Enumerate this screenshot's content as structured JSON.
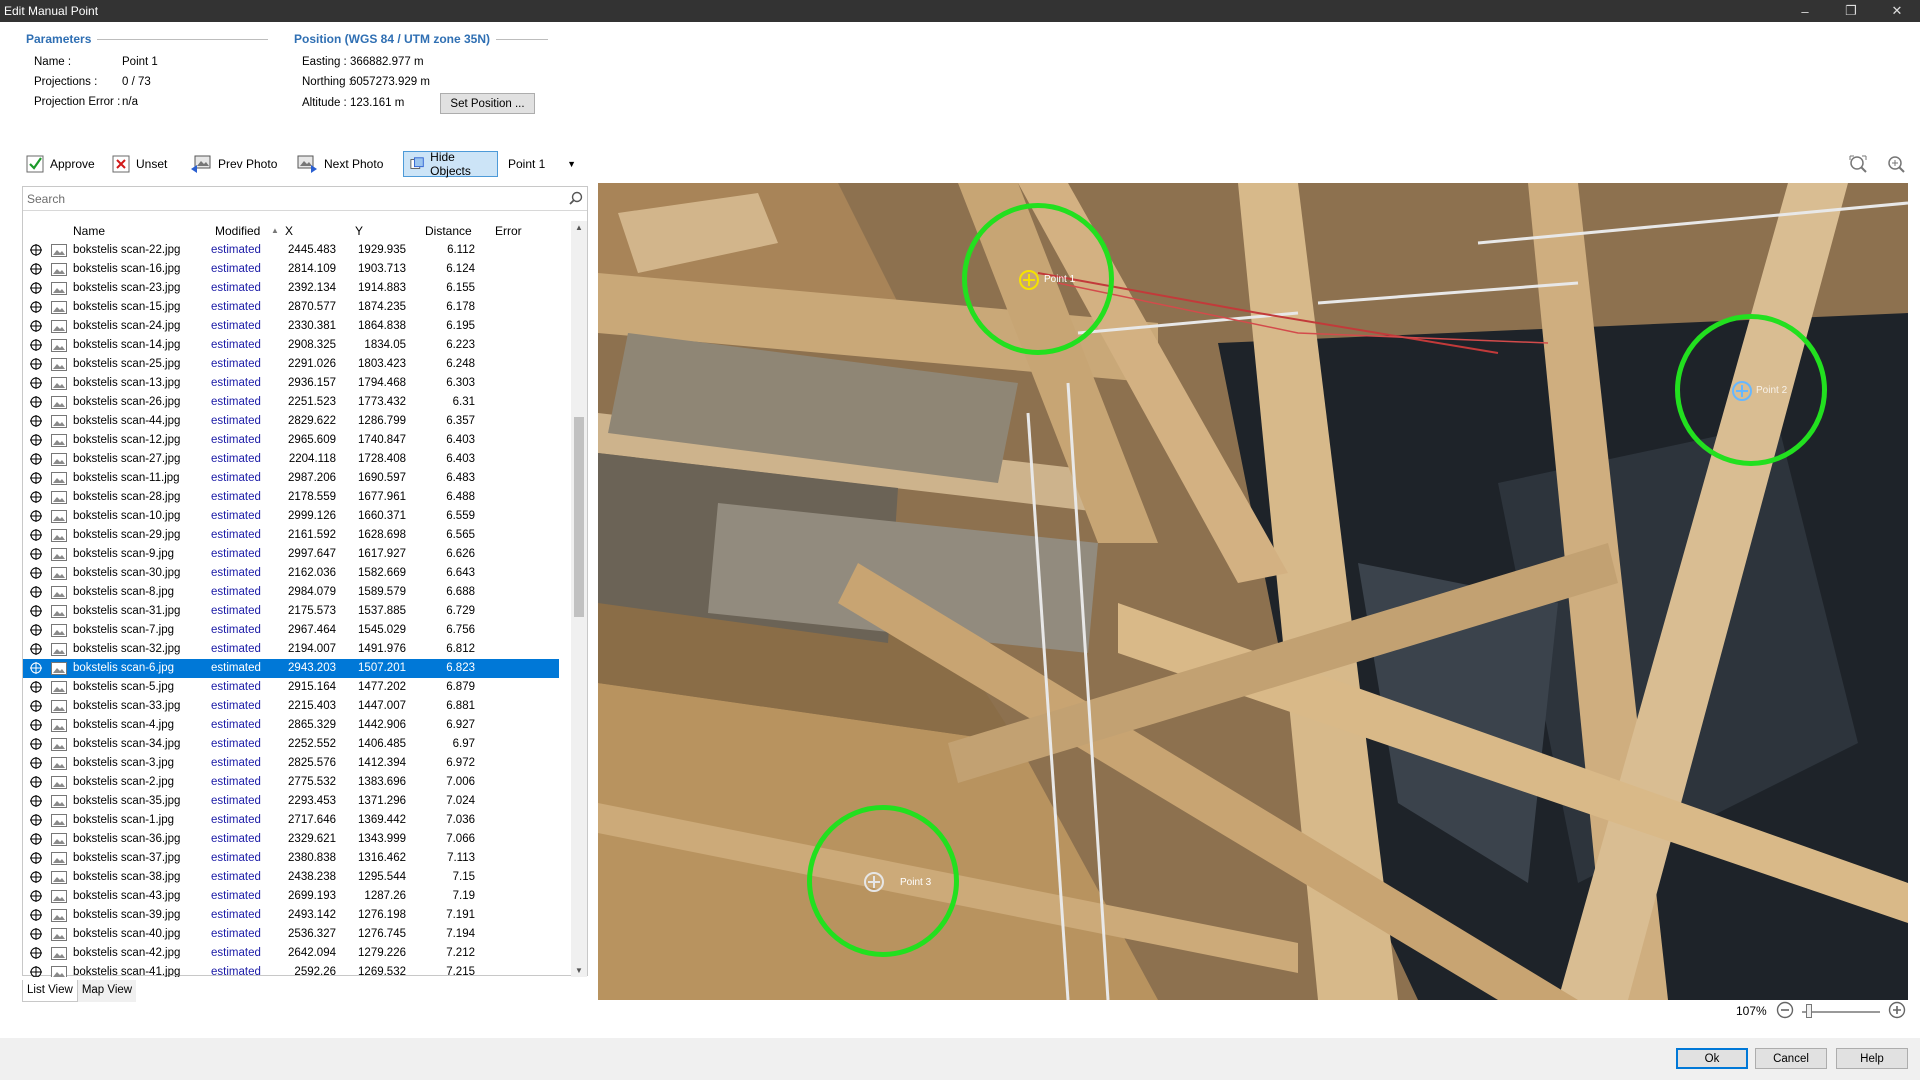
{
  "window": {
    "title": "Edit Manual Point",
    "minimize": "–",
    "restore": "❐",
    "close": "✕"
  },
  "parameters": {
    "heading": "Parameters",
    "name_label": "Name :",
    "name_value": "Point 1",
    "projections_label": "Projections :",
    "projections_value": "0 / 73",
    "projection_error_label": "Projection Error :",
    "projection_error_value": "n/a"
  },
  "position": {
    "heading": "Position (WGS 84 / UTM zone 35N)",
    "easting_label": "Easting :",
    "easting_value": "366882.977 m",
    "northing_label": "Northing :",
    "northing_value": "6057273.929 m",
    "altitude_label": "Altitude :",
    "altitude_value": "123.161 m",
    "set_position_label": "Set Position ..."
  },
  "toolbar": {
    "approve": "Approve",
    "unset": "Unset",
    "prev_photo": "Prev Photo",
    "next_photo": "Next Photo",
    "hide_objects": "Hide Objects",
    "point_select": "Point 1"
  },
  "list": {
    "search_placeholder": "Search",
    "columns": {
      "name": "Name",
      "modified": "Modified",
      "x": "X",
      "y": "Y",
      "distance": "Distance",
      "error": "Error"
    },
    "selected_index": 22,
    "rows": [
      [
        "bokstelis scan-22.jpg",
        "estimated",
        "2445.483",
        "1929.935",
        "6.112"
      ],
      [
        "bokstelis scan-16.jpg",
        "estimated",
        "2814.109",
        "1903.713",
        "6.124"
      ],
      [
        "bokstelis scan-23.jpg",
        "estimated",
        "2392.134",
        "1914.883",
        "6.155"
      ],
      [
        "bokstelis scan-15.jpg",
        "estimated",
        "2870.577",
        "1874.235",
        "6.178"
      ],
      [
        "bokstelis scan-24.jpg",
        "estimated",
        "2330.381",
        "1864.838",
        "6.195"
      ],
      [
        "bokstelis scan-14.jpg",
        "estimated",
        "2908.325",
        "1834.05",
        "6.223"
      ],
      [
        "bokstelis scan-25.jpg",
        "estimated",
        "2291.026",
        "1803.423",
        "6.248"
      ],
      [
        "bokstelis scan-13.jpg",
        "estimated",
        "2936.157",
        "1794.468",
        "6.303"
      ],
      [
        "bokstelis scan-26.jpg",
        "estimated",
        "2251.523",
        "1773.432",
        "6.31"
      ],
      [
        "bokstelis scan-44.jpg",
        "estimated",
        "2829.622",
        "1286.799",
        "6.357"
      ],
      [
        "bokstelis scan-12.jpg",
        "estimated",
        "2965.609",
        "1740.847",
        "6.403"
      ],
      [
        "bokstelis scan-27.jpg",
        "estimated",
        "2204.118",
        "1728.408",
        "6.403"
      ],
      [
        "bokstelis scan-11.jpg",
        "estimated",
        "2987.206",
        "1690.597",
        "6.483"
      ],
      [
        "bokstelis scan-28.jpg",
        "estimated",
        "2178.559",
        "1677.961",
        "6.488"
      ],
      [
        "bokstelis scan-10.jpg",
        "estimated",
        "2999.126",
        "1660.371",
        "6.559"
      ],
      [
        "bokstelis scan-29.jpg",
        "estimated",
        "2161.592",
        "1628.698",
        "6.565"
      ],
      [
        "bokstelis scan-9.jpg",
        "estimated",
        "2997.647",
        "1617.927",
        "6.626"
      ],
      [
        "bokstelis scan-30.jpg",
        "estimated",
        "2162.036",
        "1582.669",
        "6.643"
      ],
      [
        "bokstelis scan-8.jpg",
        "estimated",
        "2984.079",
        "1589.579",
        "6.688"
      ],
      [
        "bokstelis scan-31.jpg",
        "estimated",
        "2175.573",
        "1537.885",
        "6.729"
      ],
      [
        "bokstelis scan-7.jpg",
        "estimated",
        "2967.464",
        "1545.029",
        "6.756"
      ],
      [
        "bokstelis scan-32.jpg",
        "estimated",
        "2194.007",
        "1491.976",
        "6.812"
      ],
      [
        "bokstelis scan-6.jpg",
        "estimated",
        "2943.203",
        "1507.201",
        "6.823"
      ],
      [
        "bokstelis scan-5.jpg",
        "estimated",
        "2915.164",
        "1477.202",
        "6.879"
      ],
      [
        "bokstelis scan-33.jpg",
        "estimated",
        "2215.403",
        "1447.007",
        "6.881"
      ],
      [
        "bokstelis scan-4.jpg",
        "estimated",
        "2865.329",
        "1442.906",
        "6.927"
      ],
      [
        "bokstelis scan-34.jpg",
        "estimated",
        "2252.552",
        "1406.485",
        "6.97"
      ],
      [
        "bokstelis scan-3.jpg",
        "estimated",
        "2825.576",
        "1412.394",
        "6.972"
      ],
      [
        "bokstelis scan-2.jpg",
        "estimated",
        "2775.532",
        "1383.696",
        "7.006"
      ],
      [
        "bokstelis scan-35.jpg",
        "estimated",
        "2293.453",
        "1371.296",
        "7.024"
      ],
      [
        "bokstelis scan-1.jpg",
        "estimated",
        "2717.646",
        "1369.442",
        "7.036"
      ],
      [
        "bokstelis scan-36.jpg",
        "estimated",
        "2329.621",
        "1343.999",
        "7.066"
      ],
      [
        "bokstelis scan-37.jpg",
        "estimated",
        "2380.838",
        "1316.462",
        "7.113"
      ],
      [
        "bokstelis scan-38.jpg",
        "estimated",
        "2438.238",
        "1295.544",
        "7.15"
      ],
      [
        "bokstelis scan-43.jpg",
        "estimated",
        "2699.193",
        "1287.26",
        "7.19"
      ],
      [
        "bokstelis scan-39.jpg",
        "estimated",
        "2493.142",
        "1276.198",
        "7.191"
      ],
      [
        "bokstelis scan-40.jpg",
        "estimated",
        "2536.327",
        "1276.745",
        "7.194"
      ],
      [
        "bokstelis scan-42.jpg",
        "estimated",
        "2642.094",
        "1279.226",
        "7.212"
      ],
      [
        "bokstelis scan-41.jpg",
        "estimated",
        "2592.26",
        "1269.532",
        "7.215"
      ]
    ]
  },
  "tabs": {
    "list_view": "List View",
    "map_view": "Map View"
  },
  "viewer": {
    "markers": [
      "Point 1",
      "Point 2",
      "Point 3"
    ],
    "zoom_level": "107%"
  },
  "footer": {
    "ok": "Ok",
    "cancel": "Cancel",
    "help": "Help"
  },
  "colors": {
    "selection": "#0078d7",
    "marker_ring": "#22e01f",
    "active_marker": "#f5e300",
    "heading_blue": "#2f6fb3"
  }
}
